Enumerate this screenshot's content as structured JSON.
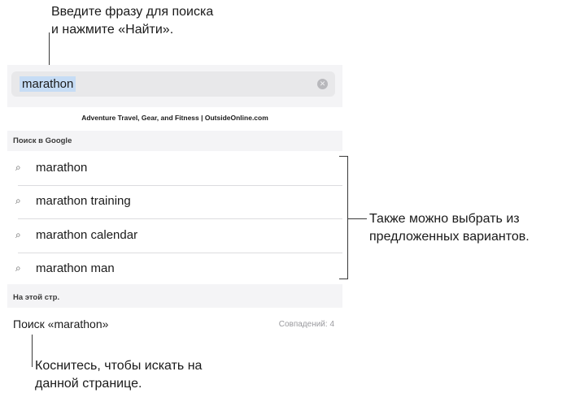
{
  "callouts": {
    "top": [
      "Введите фразу для поиска",
      "и нажмите «Найти»."
    ],
    "right": [
      "Также можно выбрать из",
      "предложенных вариантов."
    ],
    "bottom": [
      "Коснитесь, чтобы искать на",
      "данной странице."
    ]
  },
  "search": {
    "query": "marathon",
    "clear_icon": "clear-circle-icon"
  },
  "top_hit": "Adventure Travel, Gear, and Fitness | OutsideOnline.com",
  "google_section": {
    "header": "Поиск в Google",
    "suggestions": [
      "marathon",
      "marathon training",
      "marathon calendar",
      "marathon man"
    ],
    "icon": "magnifier-icon"
  },
  "page_section": {
    "header": "На этой стр.",
    "find_label": "Поиск «marathon»",
    "match_count": "Совпадений: 4"
  },
  "colors": {
    "panel_bg": "#f4f4f6",
    "field_bg": "#e8e8ea",
    "selection": "#c6dcf5"
  }
}
